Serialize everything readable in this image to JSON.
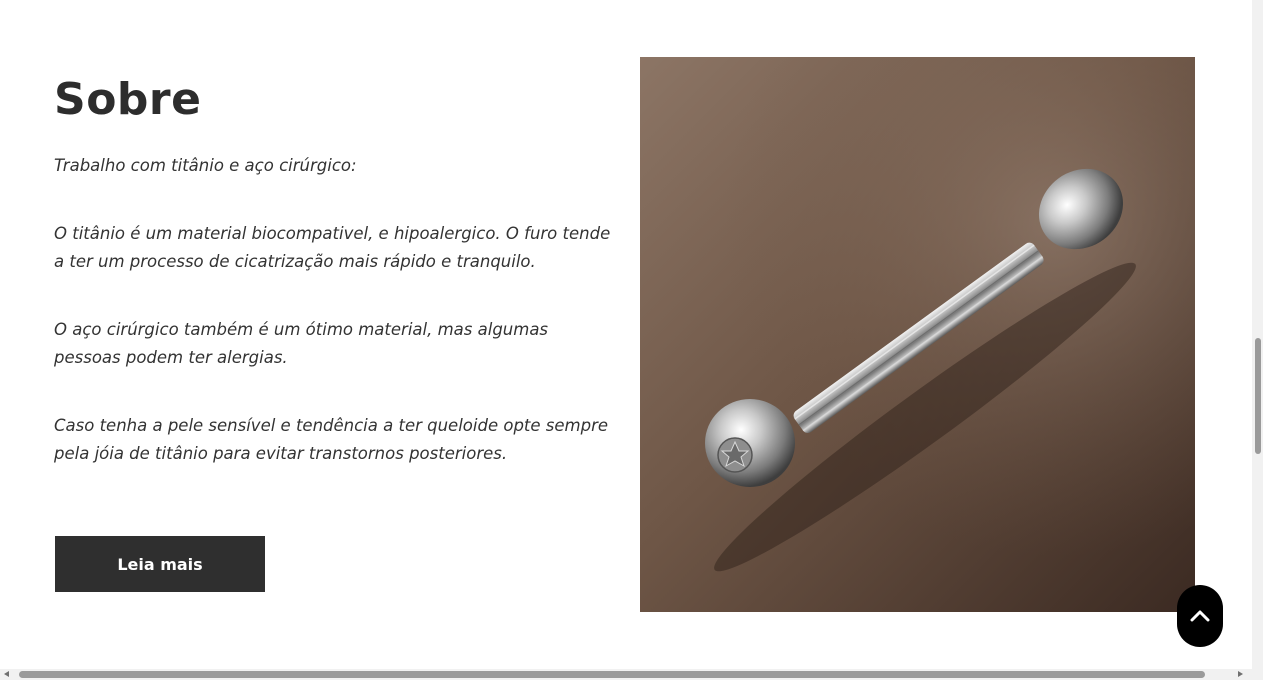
{
  "about": {
    "title": "Sobre",
    "paragraphs": [
      "Trabalho com titânio e aço cirúrgico:",
      "O titânio é um material biocompativel, e hipoalergico. O furo tende a ter um processo de cicatrização mais rápido e tranquilo.",
      "O aço cirúrgico também é um ótimo material, mas algumas pessoas podem ter alergias.",
      "Caso tenha a pele sensível e tendência a ter queloide opte sempre pela jóia de titânio para evitar transtornos posteriores."
    ],
    "read_more_label": "Leia mais"
  },
  "image": {
    "subject": "titanium barbell piercing",
    "background_color": "#6e5646"
  },
  "controls": {
    "back_to_top_icon": "chevron-up-icon"
  },
  "colors": {
    "text": "#2d2d2d",
    "button_bg": "#2f2f2f",
    "button_text": "#ffffff",
    "back_to_top_bg": "#000000"
  }
}
